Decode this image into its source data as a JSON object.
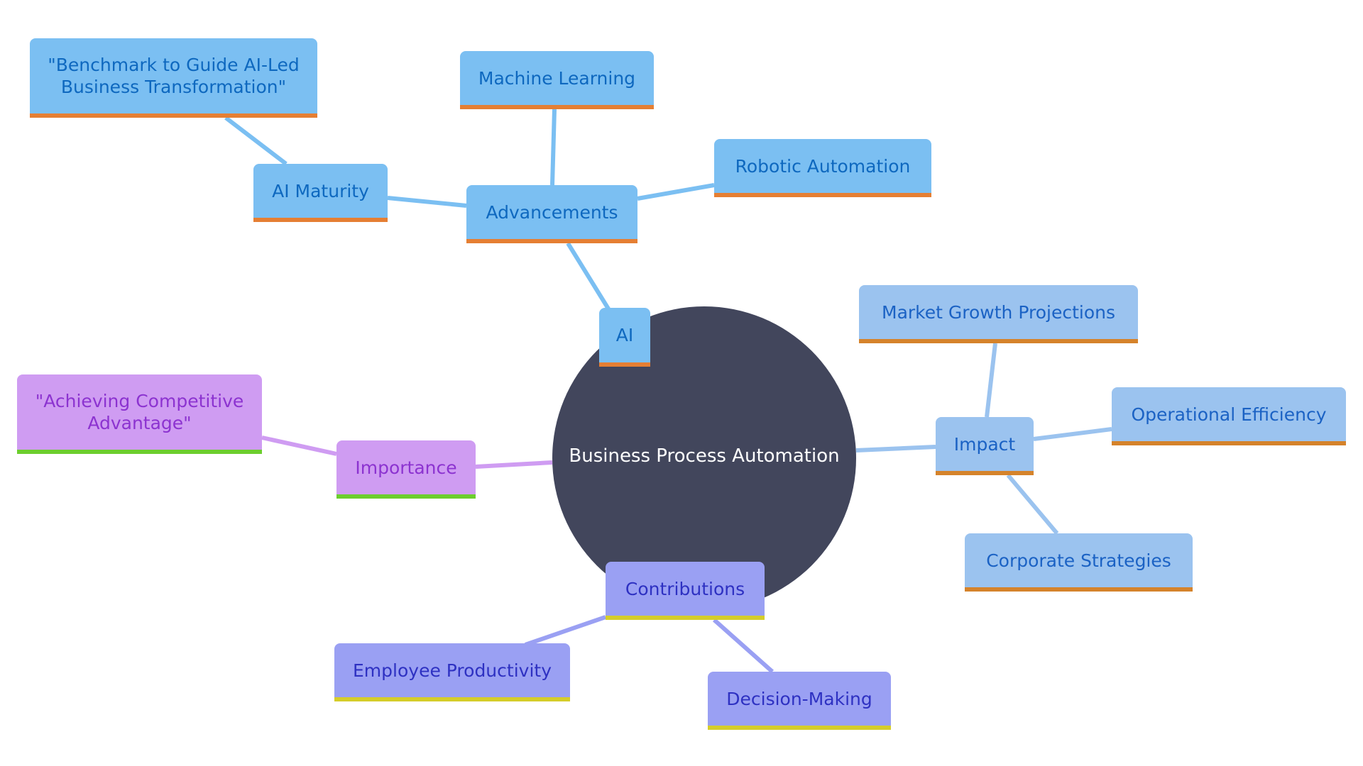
{
  "diagram": {
    "type": "mindmap",
    "root": {
      "id": "root",
      "label": "Business Process Automation"
    },
    "nodes": [
      {
        "id": "ai",
        "label": "AI",
        "parent": "root",
        "theme": "blue"
      },
      {
        "id": "advancements",
        "label": "Advancements",
        "parent": "ai",
        "theme": "blue"
      },
      {
        "id": "ai-maturity",
        "label": "AI Maturity",
        "parent": "advancements",
        "theme": "blue"
      },
      {
        "id": "benchmark",
        "label": "\"Benchmark to Guide AI-Led Business Transformation\"",
        "parent": "ai-maturity",
        "theme": "blue"
      },
      {
        "id": "machine-learning",
        "label": "Machine Learning",
        "parent": "advancements",
        "theme": "blue"
      },
      {
        "id": "robotic-automation",
        "label": "Robotic Automation",
        "parent": "advancements",
        "theme": "blue"
      },
      {
        "id": "impact",
        "label": "Impact",
        "parent": "root",
        "theme": "lblue"
      },
      {
        "id": "market-growth",
        "label": "Market Growth Projections",
        "parent": "impact",
        "theme": "lblue"
      },
      {
        "id": "operational-efficiency",
        "label": "Operational Efficiency",
        "parent": "impact",
        "theme": "lblue"
      },
      {
        "id": "corporate-strategies",
        "label": "Corporate Strategies",
        "parent": "impact",
        "theme": "lblue"
      },
      {
        "id": "contributions",
        "label": "Contributions",
        "parent": "root",
        "theme": "violet"
      },
      {
        "id": "employee-productivity",
        "label": "Employee Productivity",
        "parent": "contributions",
        "theme": "violet"
      },
      {
        "id": "decision-making",
        "label": "Decision-Making",
        "parent": "contributions",
        "theme": "violet"
      },
      {
        "id": "importance",
        "label": "Importance",
        "parent": "root",
        "theme": "purple"
      },
      {
        "id": "competitive-advantage",
        "label": "\"Achieving Competitive Advantage\"",
        "parent": "importance",
        "theme": "purple"
      }
    ],
    "colors": {
      "root_fill": "#42465c",
      "blue_fill": "#7bbff2",
      "blue_accent": "#e57f33",
      "lblue_fill": "#9bc3ef",
      "lblue_accent": "#d5832b",
      "violet_fill": "#9aa0f3",
      "violet_accent": "#d5cd2a",
      "purple_fill": "#cf9cf2",
      "purple_accent": "#6cce2e"
    }
  }
}
